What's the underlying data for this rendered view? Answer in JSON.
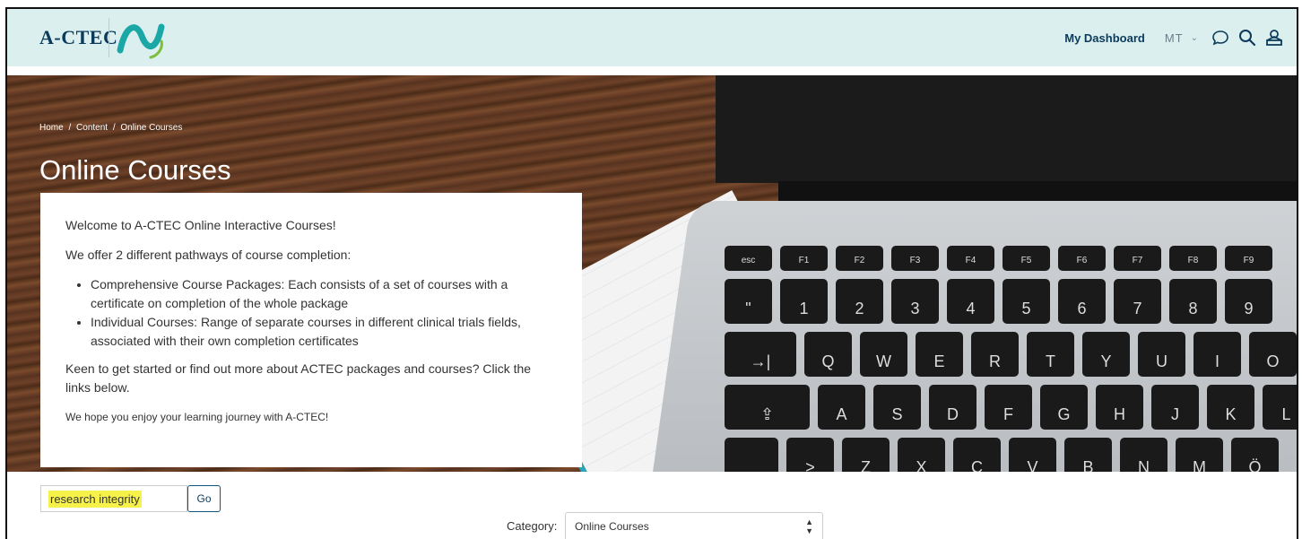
{
  "header": {
    "logo_text": "A-CTEC",
    "dashboard_link": "My Dashboard",
    "user_initials": "MT",
    "chevron": "⌄",
    "icons": [
      "chat-icon",
      "search-icon",
      "user-menu-icon"
    ]
  },
  "hero": {
    "breadcrumb": [
      "Home",
      "Content",
      "Online Courses"
    ],
    "breadcrumb_sep": "/",
    "title": "Online Courses",
    "keyboard": {
      "row1": [
        "esc",
        "F1",
        "F2",
        "F3",
        "F4",
        "F5",
        "F6",
        "F7",
        "F8",
        "F9"
      ],
      "row2": [
        "\"",
        "1",
        "2",
        "3",
        "4",
        "5",
        "6",
        "7",
        "8",
        "9"
      ],
      "row3": [
        "→|",
        "Q",
        "W",
        "E",
        "R",
        "T",
        "Y",
        "U",
        "I",
        "O"
      ],
      "row4": [
        "⇪",
        "A",
        "S",
        "D",
        "F",
        "G",
        "H",
        "J",
        "K",
        "L"
      ],
      "row5": [
        "",
        ">",
        "Z",
        "X",
        "C",
        "V",
        "B",
        "N",
        "M",
        "Ö"
      ]
    }
  },
  "intro": {
    "welcome": "Welcome to A-CTEC Online Interactive Courses!",
    "pathways": "We offer 2 different pathways of course completion:",
    "bullets": [
      "Comprehensive Course Packages: Each consists of a set of courses with a certificate on completion of the whole package",
      "Individual Courses: Range of separate courses in different clinical trials fields, associated with their own completion certificates"
    ],
    "cta": "Keen to get started or find out more about ACTEC packages and courses? Click the links below.",
    "closing": "We hope you enjoy your learning journey with A-CTEC!"
  },
  "search": {
    "value": "research integrity",
    "button": "Go"
  },
  "category": {
    "label": "Category:",
    "selected": "Online Courses"
  },
  "colors": {
    "header_bg": "#dcefef",
    "brand_navy": "#0b3a5a",
    "logo_teal": "#1aa7a6",
    "logo_green": "#7bbf3a",
    "highlight": "#f6f24a"
  }
}
